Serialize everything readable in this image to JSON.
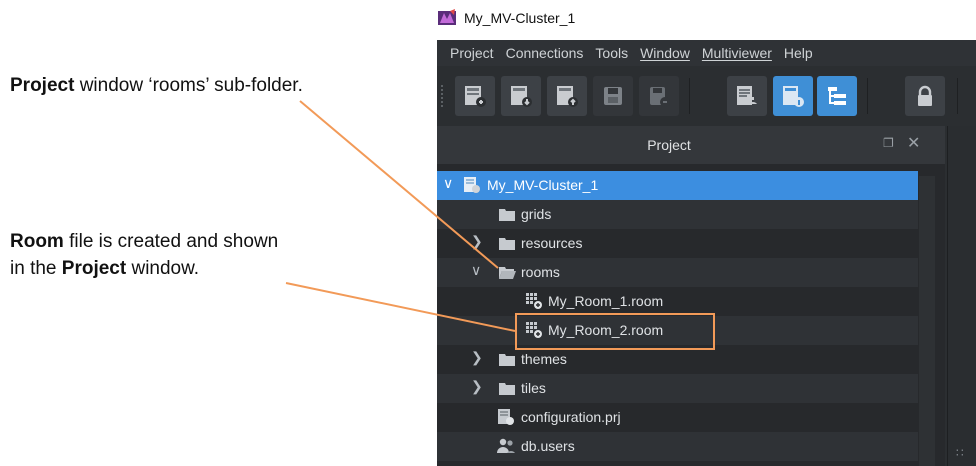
{
  "window": {
    "title": "My_MV-Cluster_1"
  },
  "menu": [
    "Project",
    "Connections",
    "Tools",
    "Window",
    "Multiviewer",
    "Help"
  ],
  "toolbar": {
    "buttons": [
      {
        "icon": "new-project-icon"
      },
      {
        "icon": "open-project-icon"
      },
      {
        "icon": "upload-project-icon"
      },
      {
        "icon": "save-icon"
      },
      {
        "icon": "save-as-icon"
      },
      {
        "icon": "alarm-log-icon"
      },
      {
        "icon": "properties-icon",
        "active": true
      },
      {
        "icon": "tree-view-icon",
        "active": true
      },
      {
        "icon": "lock-icon"
      }
    ]
  },
  "panel": {
    "title": "Project",
    "tree": [
      {
        "label": "My_MV-Cluster_1",
        "type": "project",
        "expanded": true,
        "selected": true
      },
      {
        "label": "grids",
        "type": "folder"
      },
      {
        "label": "resources",
        "type": "folder",
        "collapsed": true
      },
      {
        "label": "rooms",
        "type": "folder",
        "expanded": true
      },
      {
        "label": "My_Room_1.room",
        "type": "room"
      },
      {
        "label": "My_Room_2.room",
        "type": "room",
        "highlighted": true
      },
      {
        "label": "themes",
        "type": "folder",
        "collapsed": true
      },
      {
        "label": "tiles",
        "type": "folder",
        "collapsed": true
      },
      {
        "label": "configuration.prj",
        "type": "config"
      },
      {
        "label": "db.users",
        "type": "users"
      }
    ]
  },
  "annotations": {
    "project_note": {
      "bold": "Project",
      "text": " window ‘rooms’ sub-folder."
    },
    "room_note": {
      "bold1": "Room",
      "text1": " file is created and shown",
      "text2": "in the ",
      "bold2": "Project",
      "text3": " window."
    }
  },
  "colors": {
    "accent": "#3c8ee0",
    "callout": "#f29a58",
    "panel_bg": "#27292c"
  }
}
